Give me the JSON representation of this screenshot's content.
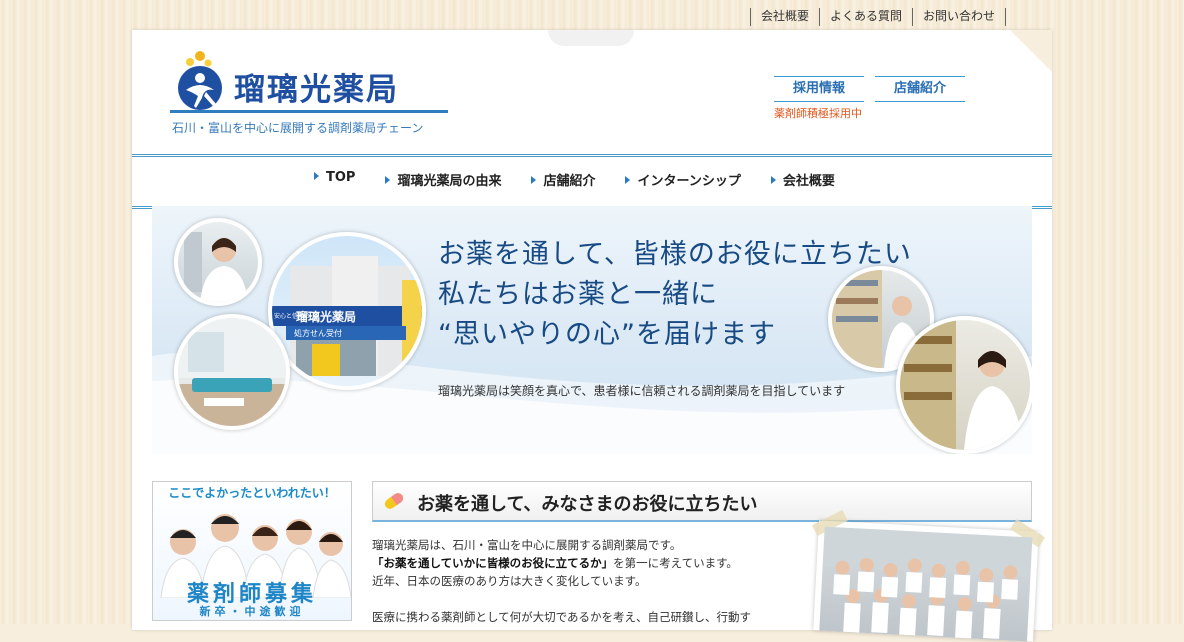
{
  "top_links": [
    "会社概要",
    "よくある質問",
    "お問い合わせ"
  ],
  "logo": {
    "name": "瑠璃光薬局",
    "tagline": "石川・富山を中心に展開する調剤薬局チェーン"
  },
  "header_buttons": {
    "recruit": "採用情報",
    "stores": "店舗紹介",
    "recruit_note": "薬剤師積極採用中"
  },
  "nav": [
    "TOP",
    "瑠璃光薬局の由来",
    "店舗紹介",
    "インターンシップ",
    "会社概要"
  ],
  "hero": {
    "line1": "お薬を通して、皆様のお役に立ちたい",
    "line2": "私たちはお薬と一緒に",
    "line3": "“思いやりの心”を届けます",
    "sub": "瑠璃光薬局は笑顔を真心で、患者様に信頼される調剤薬局を目指しています",
    "storefront_sign": "瑠璃光薬局",
    "storefront_small": "安心と信頼の",
    "storefront_rx": "処方せん受付"
  },
  "side_banner": {
    "head": "ここでよかったといわれたい！",
    "title": "薬剤師募集",
    "sub": "新卒・中途歓迎"
  },
  "section": {
    "title": "お薬を通して、みなさまのお役に立ちたい",
    "p1": "瑠璃光薬局は、石川・富山を中心に展開する調剤薬局です。",
    "p2_bold": "「お薬を通していかに皆様のお役に立てるか」",
    "p2_rest": "を第一に考えています。",
    "p3": "近年、日本の医療のあり方は大きく変化しています。",
    "p4": "医療に携わる薬剤師として何が大切であるかを考え、自己研鑚し、行動す"
  },
  "colors": {
    "brand_blue": "#1e4fa1",
    "accent_blue": "#2f7fc0",
    "orange": "#e0561a"
  }
}
